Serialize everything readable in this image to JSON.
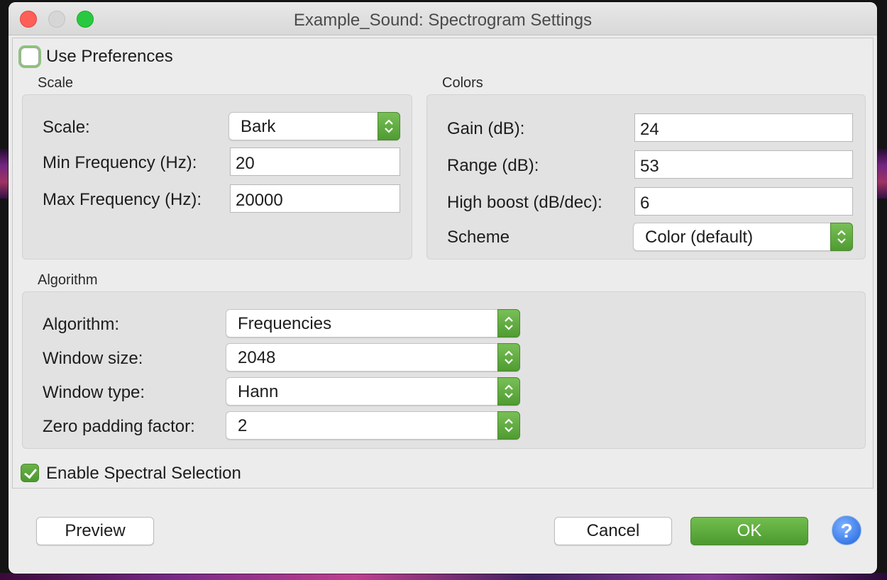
{
  "window": {
    "title": "Example_Sound: Spectrogram Settings"
  },
  "use_preferences": {
    "label": "Use Preferences",
    "checked": false
  },
  "scale": {
    "group_title": "Scale",
    "scale_label": "Scale:",
    "scale_value": "Bark",
    "min_freq_label": "Min Frequency (Hz):",
    "min_freq_value": "20",
    "max_freq_label": "Max Frequency (Hz):",
    "max_freq_value": "20000"
  },
  "colors": {
    "group_title": "Colors",
    "gain_label": "Gain (dB):",
    "gain_value": "24",
    "range_label": "Range (dB):",
    "range_value": "53",
    "boost_label": "High boost (dB/dec):",
    "boost_value": "6",
    "scheme_label": "Scheme",
    "scheme_value": "Color (default)"
  },
  "algorithm": {
    "group_title": "Algorithm",
    "algorithm_label": "Algorithm:",
    "algorithm_value": "Frequencies",
    "window_size_label": "Window size:",
    "window_size_value": "2048",
    "window_type_label": "Window type:",
    "window_type_value": "Hann",
    "zero_padding_label": "Zero padding factor:",
    "zero_padding_value": "2"
  },
  "spectral_selection": {
    "label": "Enable Spectral Selection",
    "checked": true
  },
  "buttons": {
    "preview": "Preview",
    "cancel": "Cancel",
    "ok": "OK",
    "help": "?"
  },
  "colors_theme": {
    "accent_green": "#5aa83a",
    "help_blue": "#3a7ae8",
    "close_red": "#fe5f57"
  }
}
